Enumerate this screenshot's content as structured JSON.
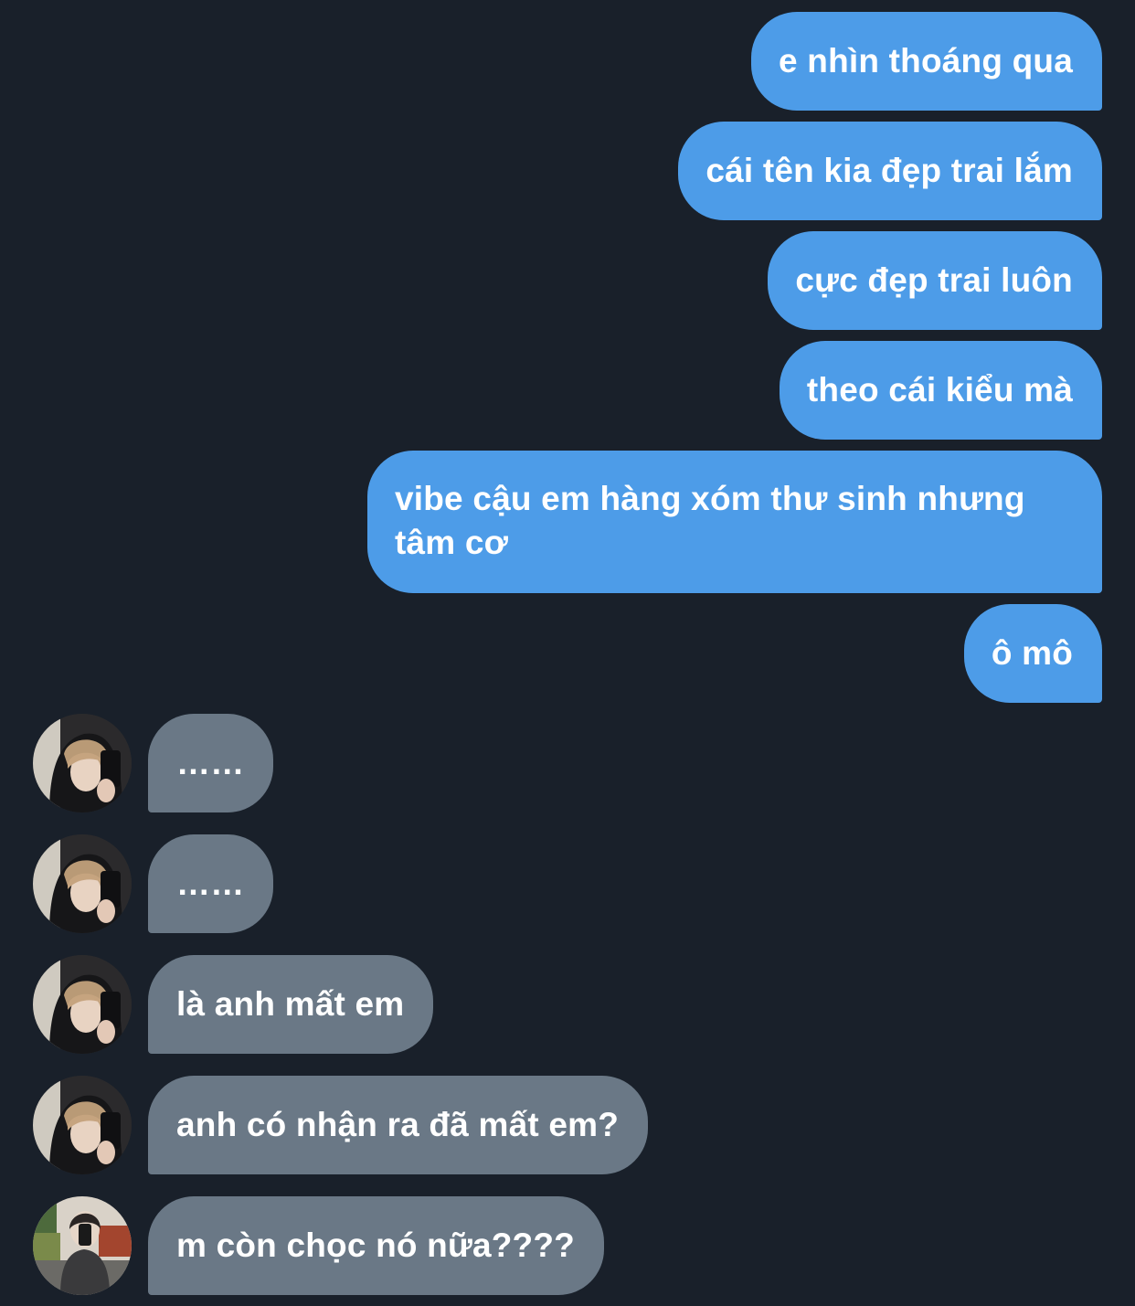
{
  "messages": [
    {
      "side": "out",
      "text": "e nhìn thoáng qua"
    },
    {
      "side": "out",
      "text": "cái tên kia đẹp trai lắm"
    },
    {
      "side": "out",
      "text": "cực đẹp trai luôn"
    },
    {
      "side": "out",
      "text": "theo cái kiểu mà"
    },
    {
      "side": "out",
      "text": "vibe cậu em hàng xóm thư sinh nhưng tâm cơ"
    },
    {
      "side": "out",
      "text": "ô mô"
    },
    {
      "side": "in",
      "text": "……"
    },
    {
      "side": "in",
      "text": "……"
    },
    {
      "side": "in",
      "text": "là anh mất em"
    },
    {
      "side": "in",
      "text": "anh có nhận ra đã mất em?"
    },
    {
      "side": "in",
      "text": "m còn chọc nó nữa????"
    }
  ],
  "colors": {
    "background": "#19202a",
    "outgoing_bubble": "#4d9ce8",
    "incoming_bubble": "#6a7886",
    "text": "#ffffff"
  }
}
